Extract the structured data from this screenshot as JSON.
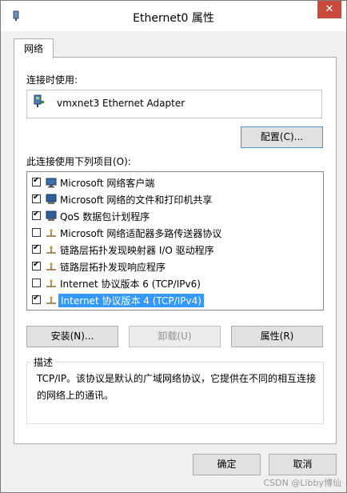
{
  "window": {
    "title": "Ethernet0 属性",
    "close_glyph": "✕"
  },
  "tabs": [
    {
      "label": "网络"
    }
  ],
  "connect_using": {
    "label": "连接时使用:",
    "adapter_name": "vmxnet3 Ethernet Adapter",
    "configure_button": "配置(C)..."
  },
  "components": {
    "label": "此连接使用下列项目(O):",
    "items": [
      {
        "label": "Microsoft 网络客户端",
        "checked": true,
        "icon": "client-icon"
      },
      {
        "label": "Microsoft 网络的文件和打印机共享",
        "checked": true,
        "icon": "service-icon"
      },
      {
        "label": "QoS 数据包计划程序",
        "checked": true,
        "icon": "service-icon"
      },
      {
        "label": "Microsoft 网络适配器多路传送器协议",
        "checked": false,
        "icon": "protocol-icon"
      },
      {
        "label": "链路层拓扑发现映射器 I/O 驱动程序",
        "checked": true,
        "icon": "protocol-icon"
      },
      {
        "label": "链路层拓扑发现响应程序",
        "checked": true,
        "icon": "protocol-icon"
      },
      {
        "label": "Internet 协议版本 6 (TCP/IPv6)",
        "checked": false,
        "icon": "protocol-icon"
      },
      {
        "label": "Internet 协议版本 4 (TCP/IPv4)",
        "checked": true,
        "icon": "protocol-icon",
        "selected": true
      }
    ]
  },
  "action_buttons": {
    "install": "安装(N)...",
    "uninstall": "卸载(U)",
    "properties": "属性(R)"
  },
  "description": {
    "legend": "描述",
    "text": "TCP/IP。该协议是默认的广域网络协议，它提供在不同的相互连接的网络上的通讯。"
  },
  "dialog_buttons": {
    "ok": "确定",
    "cancel": "取消"
  },
  "watermark": "CSDN @Libby博仙",
  "colors": {
    "selection": "#3399ff",
    "close": "#c74a3d"
  }
}
